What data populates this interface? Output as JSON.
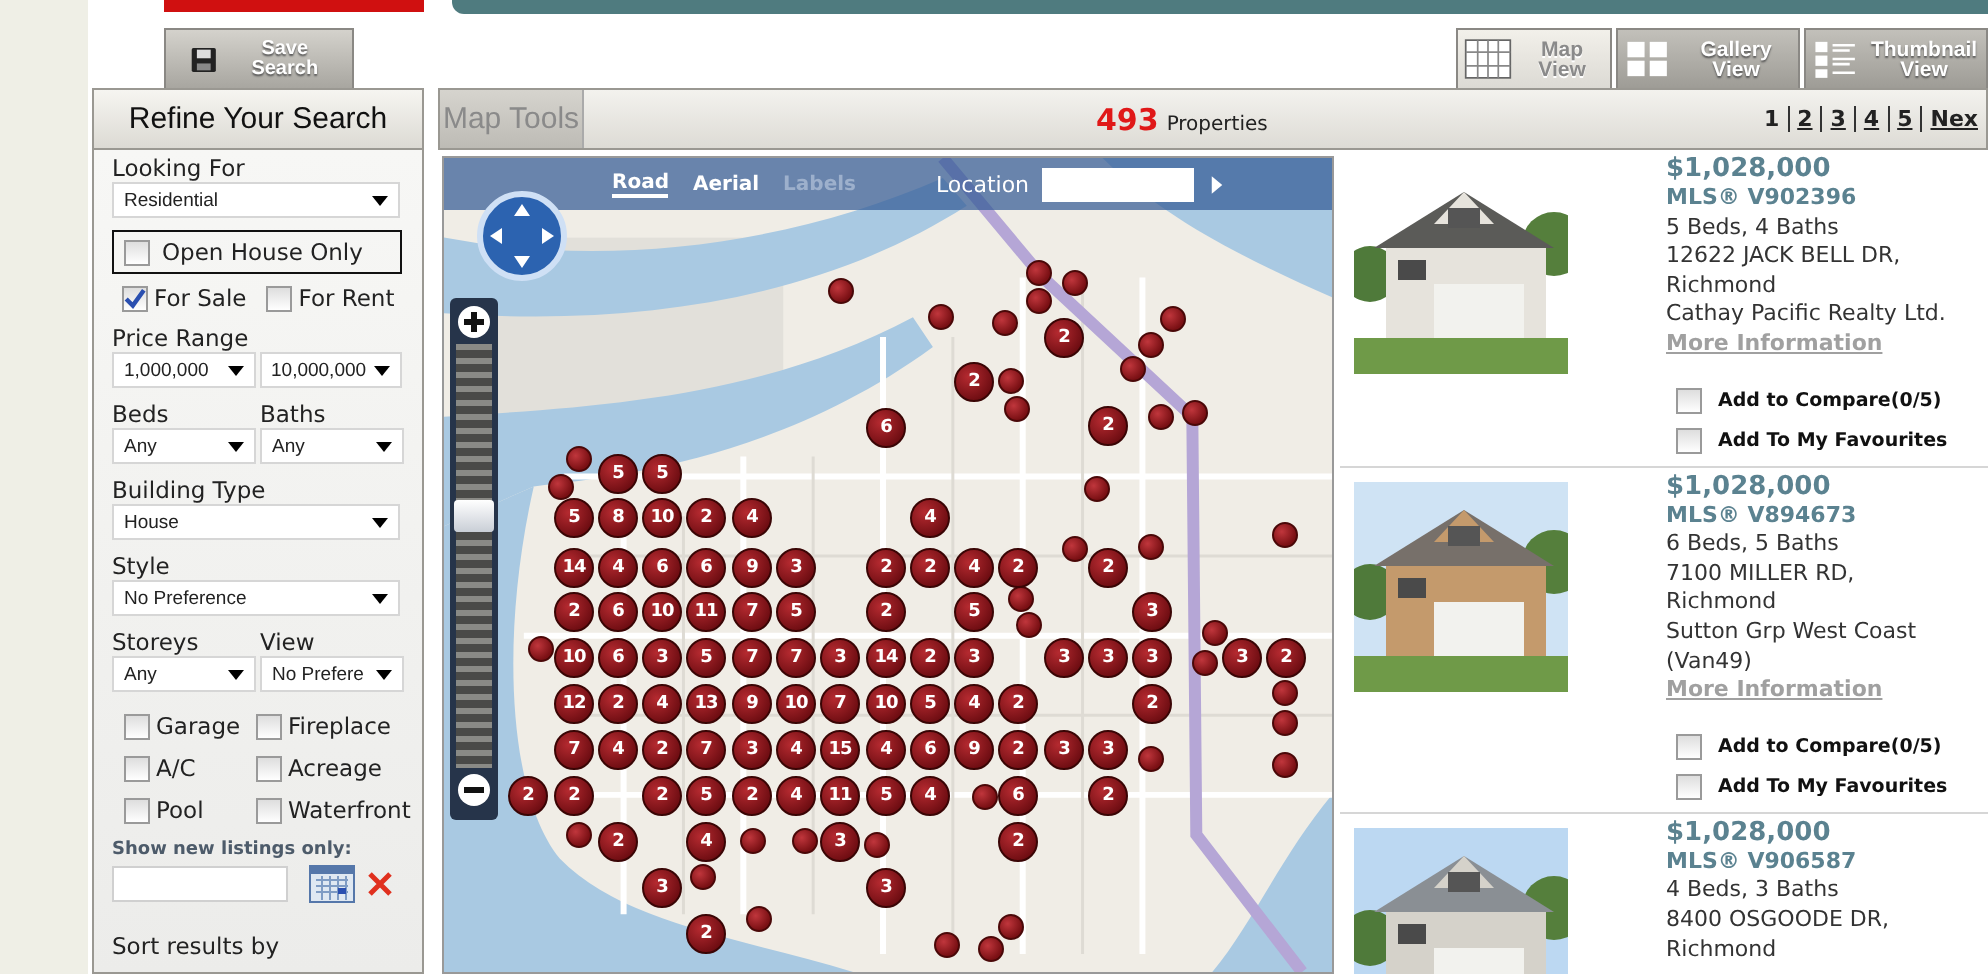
{
  "header": {
    "save_search": "Save Search",
    "views": [
      {
        "kind": "map",
        "label": "Map View",
        "selected": true
      },
      {
        "kind": "gallery",
        "label": "Gallery View",
        "selected": false
      },
      {
        "kind": "thumbnail",
        "label": "Thumbnail View",
        "selected": false
      }
    ]
  },
  "sidebar": {
    "title": "Refine Your Search",
    "looking_for": {
      "label": "Looking For",
      "value": "Residential"
    },
    "open_house": {
      "label": "Open House Only",
      "checked": false
    },
    "listing_types": [
      {
        "label": "For Sale",
        "checked": true
      },
      {
        "label": "For Rent",
        "checked": false
      }
    ],
    "filters": [
      {
        "kind": "range",
        "label": "Price Range",
        "values": [
          "1,000,000",
          "10,000,000"
        ]
      },
      {
        "kind": "pair",
        "fields": [
          {
            "label": "Beds",
            "value": "Any"
          },
          {
            "label": "Baths",
            "value": "Any"
          }
        ]
      },
      {
        "kind": "single",
        "label": "Building Type",
        "value": "House"
      },
      {
        "kind": "single",
        "label": "Style",
        "value": "No Preference"
      },
      {
        "kind": "pair",
        "fields": [
          {
            "label": "Storeys",
            "value": "Any"
          },
          {
            "label": "View",
            "value": "No Prefere"
          }
        ]
      }
    ],
    "features": [
      {
        "label": "Garage",
        "checked": false
      },
      {
        "label": "Fireplace",
        "checked": false
      },
      {
        "label": "A/C",
        "checked": false
      },
      {
        "label": "Acreage",
        "checked": false
      },
      {
        "label": "Pool",
        "checked": false
      },
      {
        "label": "Waterfront",
        "checked": false
      }
    ],
    "new_listings": {
      "label": "Show new listings only:"
    },
    "sort_label": "Sort results by"
  },
  "results_bar": {
    "map_tools": "Map Tools",
    "count": "493",
    "count_label": "Properties",
    "pages": [
      {
        "label": "1",
        "selected": true
      },
      {
        "label": "2",
        "selected": false
      },
      {
        "label": "3",
        "selected": false
      },
      {
        "label": "4",
        "selected": false
      },
      {
        "label": "5",
        "selected": false
      },
      {
        "label": "Nex",
        "selected": false
      }
    ]
  },
  "map": {
    "styles": [
      {
        "label": "Road",
        "selected": true,
        "disabled": false
      },
      {
        "label": "Aerial",
        "selected": false,
        "disabled": false
      },
      {
        "label": "Labels",
        "selected": false,
        "disabled": true
      }
    ],
    "location_label": "Location",
    "zoom": {
      "level": 0.6
    },
    "clusters": [
      "2",
      "2",
      "6",
      "2",
      "5",
      "5",
      "5",
      "8",
      "10",
      "2",
      "4",
      "4",
      "14",
      "4",
      "6",
      "6",
      "9",
      "3",
      "2",
      "2",
      "4",
      "2",
      "2",
      "2",
      "6",
      "10",
      "11",
      "7",
      "5",
      "2",
      "5",
      "3",
      "10",
      "6",
      "3",
      "5",
      "7",
      "7",
      "3",
      "14",
      "2",
      "3",
      "3",
      "3",
      "3",
      "3",
      "2",
      "12",
      "2",
      "4",
      "13",
      "9",
      "10",
      "7",
      "10",
      "5",
      "4",
      "2",
      "2",
      "7",
      "4",
      "2",
      "7",
      "3",
      "4",
      "15",
      "4",
      "6",
      "9",
      "2",
      "3",
      "3",
      "2",
      "2",
      "2",
      "5",
      "2",
      "4",
      "11",
      "5",
      "4",
      "6",
      "2",
      "2",
      "4",
      "3",
      "2",
      "3",
      "3",
      "2"
    ]
  },
  "listings": [
    {
      "price": "$1,028,000",
      "mls": "MLS® V902396",
      "beds_baths": "5 Beds, 4 Baths",
      "address": "12622 JACK BELL DR, Richmond",
      "agent": "Cathay Pacific Realty Ltd.",
      "more": "More Information",
      "compare": {
        "label": "Add to Compare(0/5)",
        "checked": false
      },
      "favourite": {
        "label": "Add To My Favourites",
        "checked": false
      }
    },
    {
      "price": "$1,028,000",
      "mls": "MLS® V894673",
      "beds_baths": "6 Beds, 5 Baths",
      "address": "7100 MILLER RD, Richmond",
      "agent": "Sutton Grp West Coast (Van49)",
      "more": "More Information",
      "compare": {
        "label": "Add to Compare(0/5)",
        "checked": false
      },
      "favourite": {
        "label": "Add To My Favourites",
        "checked": false
      }
    },
    {
      "price": "$1,028,000",
      "mls": "MLS® V906587",
      "beds_baths": "4 Beds, 3 Baths",
      "address": "8400 OSGOODE DR, Richmond"
    }
  ]
}
